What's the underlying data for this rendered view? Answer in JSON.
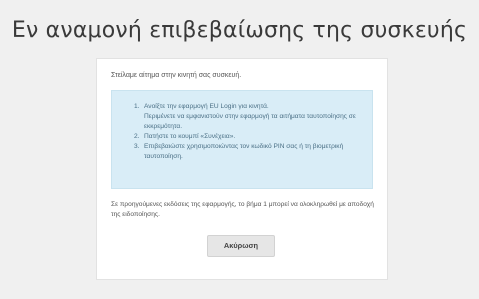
{
  "page": {
    "title": "Εν αναμονή επιβεβαίωσης της συσκευής"
  },
  "card": {
    "intro": "Στείλαμε αίτημα στην κινητή σας συσκευή.",
    "steps": [
      {
        "line1": "Ανοίξτε την εφαρμογή EU Login για κινητά.",
        "line2": "Περιμένετε να εμφανιστούν στην εφαρμογή τα αιτήματα ταυτοποίησης σε εκκρεμότητα."
      },
      {
        "line1": "Πατήστε το κουμπί «Συνέχεια»."
      },
      {
        "line1": "Επιβεβαιώστε χρησιμοποιώντας τον κωδικό PIN σας ή τη βιομετρική ταυτοποίηση."
      }
    ],
    "footnote": "Σε προηγούμενες εκδόσεις της εφαρμογής, το βήμα 1 μπορεί να ολοκληρωθεί με αποδοχή της ειδοποίησης.",
    "cancel_label": "Ακύρωση"
  },
  "colors": {
    "page_background": "#f0f0f0",
    "info_box_background": "#d9edf7",
    "info_box_text": "#4a6f85",
    "button_background": "#e6e6e6"
  }
}
